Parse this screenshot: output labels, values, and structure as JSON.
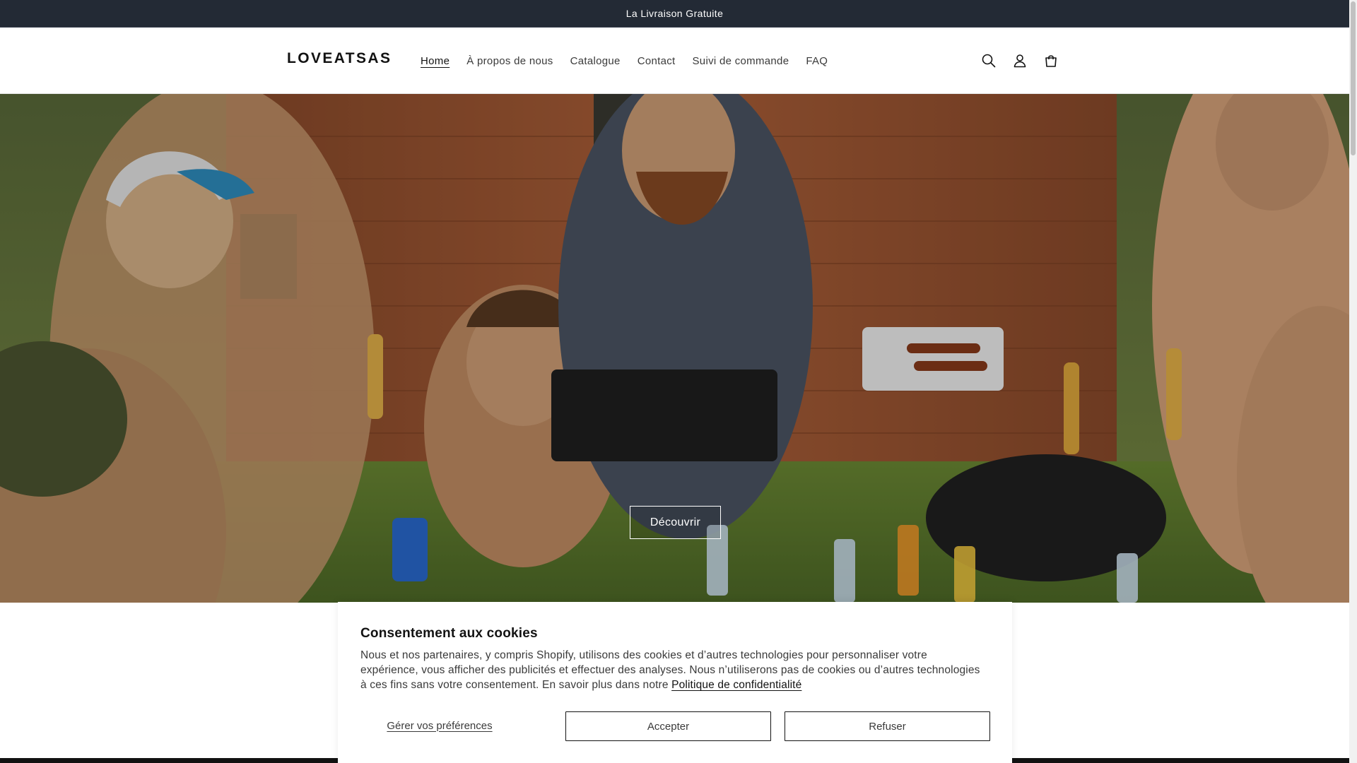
{
  "announcement": {
    "text": "La Livraison Gratuite"
  },
  "header": {
    "logo": "LOVEATSAS",
    "nav": [
      {
        "label": "Home",
        "active": true
      },
      {
        "label": "À propos de nous",
        "active": false
      },
      {
        "label": "Catalogue",
        "active": false
      },
      {
        "label": "Contact",
        "active": false
      },
      {
        "label": "Suivi de commande",
        "active": false
      },
      {
        "label": "FAQ",
        "active": false
      }
    ],
    "icons": [
      "search-icon",
      "account-icon",
      "cart-icon"
    ]
  },
  "hero": {
    "button_label": "Découvrir",
    "image_description_icon": "hero-image"
  },
  "cookie_banner": {
    "title": "Consentement aux cookies",
    "text": "Nous et nos partenaires, y compris Shopify, utilisons des cookies et d’autres technologies pour personnaliser votre expérience, vous afficher des publicités et effectuer des analyses. Nous n’utiliserons pas de cookies ou d’autres technologies à ces fins sans votre consentement. En savoir plus dans notre",
    "policy_link": "Politique de confidentialité",
    "manage_label": "Gérer vos préférences",
    "accept_label": "Accepter",
    "refuse_label": "Refuser"
  },
  "colors": {
    "announcement_bg": "#232a35",
    "text": "#121212",
    "button_border": "#121212"
  }
}
